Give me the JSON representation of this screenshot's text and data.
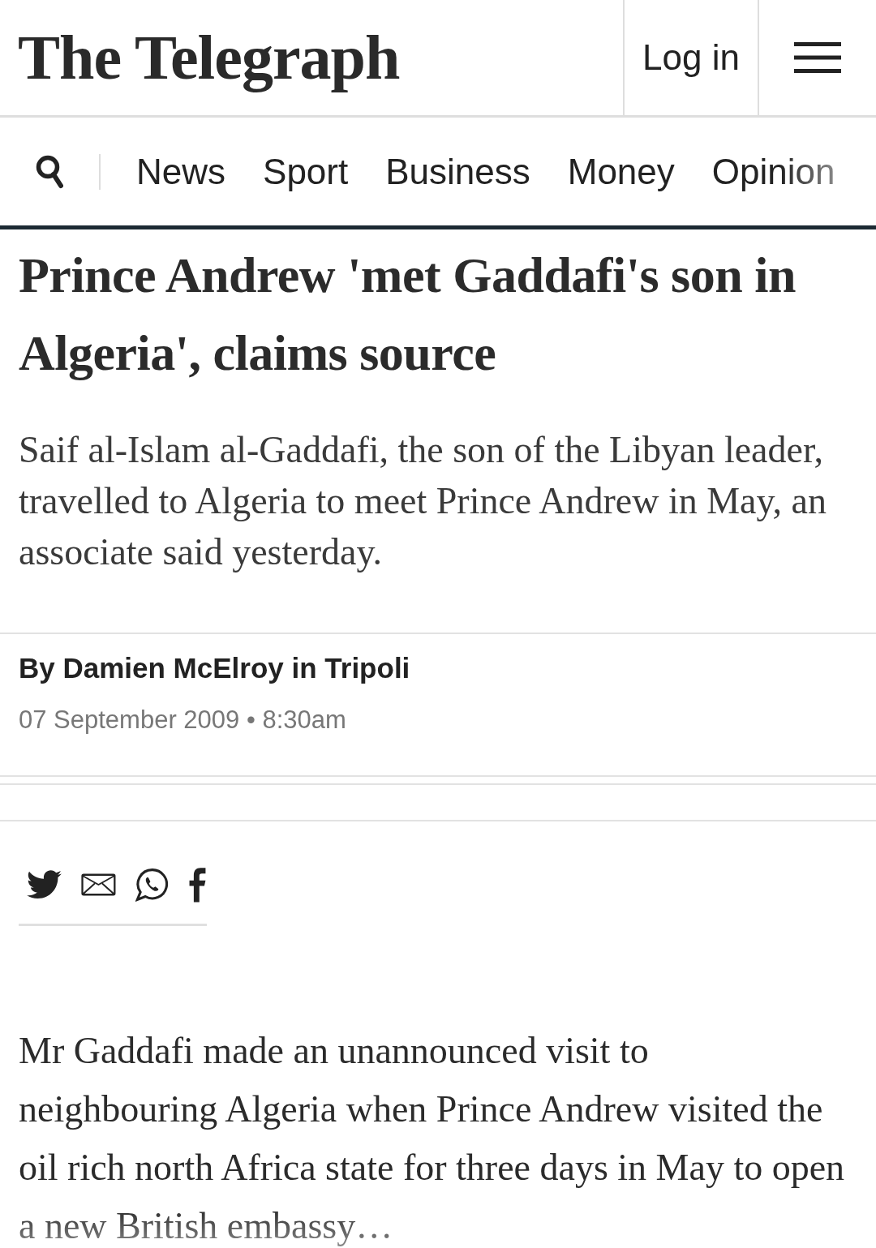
{
  "header": {
    "logo": "The Telegraph",
    "login": "Log in"
  },
  "nav": {
    "items": [
      "News",
      "Sport",
      "Business",
      "Money",
      "Opinion"
    ]
  },
  "article": {
    "headline": "Prince Andrew 'met Gaddafi's son in Algeria', claims source",
    "standfirst": "Saif al-Islam al-Gaddafi, the son of the Libyan leader, travelled to Algeria to meet Prince Andrew in May, an associate said yesterday.",
    "byline": "By Damien McElroy in Tripoli",
    "dateline": "07 September 2009 • 8:30am",
    "body": "Mr Gaddafi made an unannounced visit to neighbouring Algeria when Prince Andrew visited the oil rich north Africa state for three days in May to open a new British embassy…"
  }
}
